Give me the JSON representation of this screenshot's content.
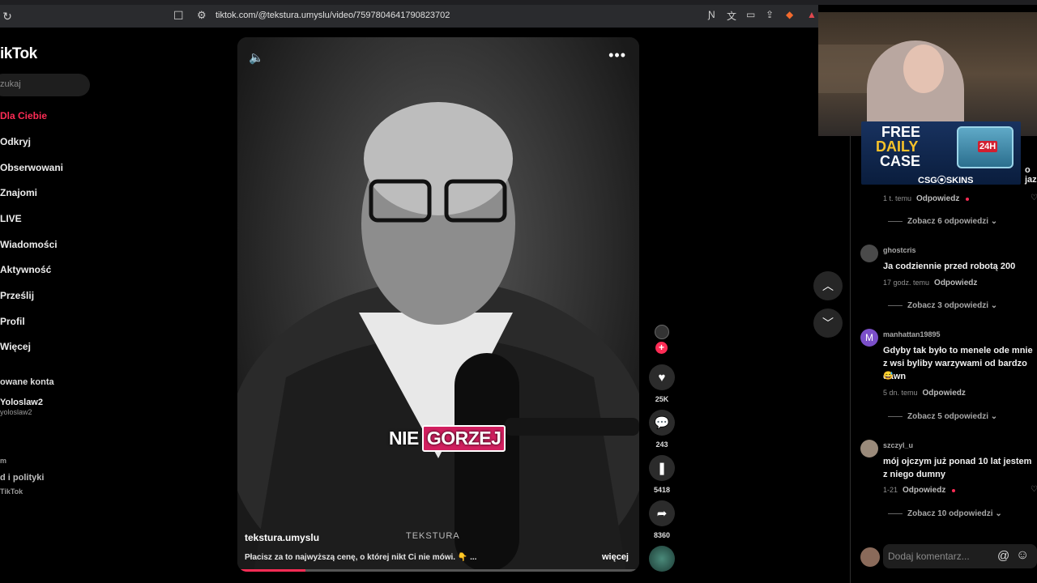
{
  "browser": {
    "url": "tiktok.com/@tekstura.umyslu/video/7597804641790823702"
  },
  "sidebar": {
    "logo": "ikTok",
    "search_placeholder": "zukaj",
    "nav": [
      {
        "label": "Dla Ciebie",
        "active": true
      },
      {
        "label": "Odkryj"
      },
      {
        "label": "Obserwowani"
      },
      {
        "label": "Znajomi"
      },
      {
        "label": "LIVE"
      },
      {
        "label": "Wiadomości"
      },
      {
        "label": "Aktywność"
      },
      {
        "label": "Prześlij"
      },
      {
        "label": "Profil"
      },
      {
        "label": "Więcej"
      }
    ],
    "followed_title": "owane konta",
    "account_name": "Yoloslaw2",
    "account_handle": "yoloslaw2",
    "footer_1": "m",
    "footer_2": "d i polityki",
    "footer_3": "TikTok"
  },
  "video": {
    "caption_word_1": "NIE",
    "caption_word_2": "GORZEJ",
    "watermark": "TEKSTURA",
    "author": "tekstura.umyslu",
    "description": "Płacisz za to najwyższą cenę, o której nikt Ci nie mówi. 👇 ...",
    "more_label": "więcej",
    "progress": 0.17
  },
  "actions": {
    "likes": "25K",
    "comments": "243",
    "saves": "5418",
    "shares": "8360"
  },
  "comments": {
    "fragment": "o jaz",
    "items": [
      {
        "meta": "1 t. temu",
        "reply": "Odpowiedz",
        "replies": "Zobacz 6 odpowiedzi"
      },
      {
        "user": "ghostcris",
        "text": "Ja codziennie przed robotą 200",
        "meta": "17 godz. temu",
        "reply": "Odpowiedz",
        "replies": "Zobacz 3 odpowiedzi"
      },
      {
        "user": "manhattan19895",
        "avatar_letter": "M",
        "text": "Gdyby tak było to menele ode mnie z wsi byliby warzywami od bardzo dawn",
        "emoji": "😅",
        "meta": "5 dn. temu",
        "reply": "Odpowiedz",
        "replies": "Zobacz 5 odpowiedzi"
      },
      {
        "user": "szczyl_u",
        "text": "mój ojczym już ponad 10 lat jestem z niego dumny",
        "meta": "1-21",
        "reply": "Odpowiedz",
        "replies": "Zobacz 10 odpowiedzi"
      }
    ],
    "input_placeholder": "Dodaj komentarz..."
  },
  "ad": {
    "line1": "FREE",
    "line2": "DAILY",
    "line3": "CASE",
    "brand": "CSG⦿SKINS",
    "badge": "24H"
  },
  "colors": {
    "accent": "#fe2c55",
    "background": "#000000",
    "panel": "#1e1e1e"
  }
}
